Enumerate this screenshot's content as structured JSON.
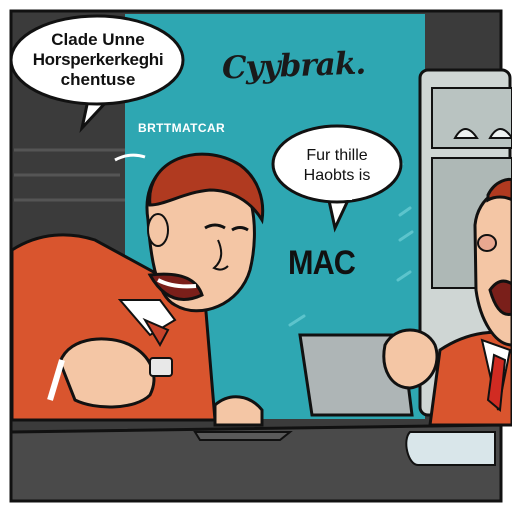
{
  "speech_left": {
    "lines": [
      "Clade Unne",
      "Horsperkerkeghi",
      "chentuse"
    ]
  },
  "wall_logo": "Cyybrak.",
  "wall_sign": "BRTTMATCAR",
  "speech_right": {
    "lines": [
      "Fur thille",
      "Haobts is"
    ]
  },
  "wall_word": "MAC",
  "colors": {
    "wall_teal": "#2ea7b2",
    "dark_wall": "#3a3a3a",
    "desk": "#4a4a4a",
    "orange_jacket": "#d9552e",
    "skin": "#f4c6a5",
    "hair": "#b03a20"
  }
}
